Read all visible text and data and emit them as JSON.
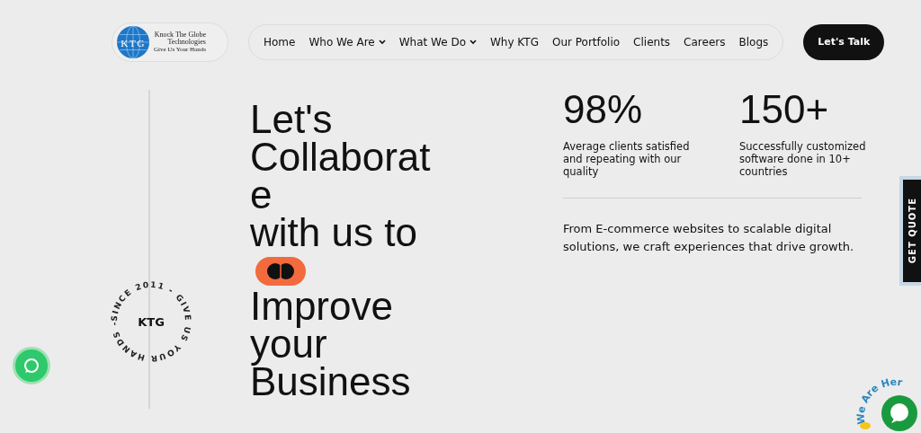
{
  "header": {
    "logo": {
      "monogram": "KTG",
      "name_line1": "Knock The Globe",
      "name_line2": "Technologies",
      "tagline": "Give Us Your Hands"
    },
    "nav": [
      {
        "label": "Home",
        "dropdown": false
      },
      {
        "label": "Who We Are",
        "dropdown": true
      },
      {
        "label": "What We Do",
        "dropdown": true
      },
      {
        "label": "Why KTG",
        "dropdown": false
      },
      {
        "label": "Our Portfolio",
        "dropdown": false
      },
      {
        "label": "Clients",
        "dropdown": false
      },
      {
        "label": "Careers",
        "dropdown": false
      },
      {
        "label": "Blogs",
        "dropdown": false
      }
    ],
    "cta": "Let's Talk"
  },
  "badge": {
    "ring_text": "SINCE 2011 - GIVE US YOUR HANDS -",
    "center": "KTG"
  },
  "headline": {
    "before": [
      "Let's",
      "Collaborat",
      "e",
      "with us to"
    ],
    "after": [
      "Improve",
      "your",
      "Business"
    ]
  },
  "stats": [
    {
      "value": "98%",
      "caption": "Average clients satisfied and repeating with our quality"
    },
    {
      "value": "150+",
      "caption": "Successfully customized software done in 10+ countries"
    }
  ],
  "intro": "From E-commerce websites to scalable digital solutions, we craft experiences that drive growth.",
  "side_tab": "GET QUOTE",
  "chat": {
    "greeting": "We Are Her"
  }
}
